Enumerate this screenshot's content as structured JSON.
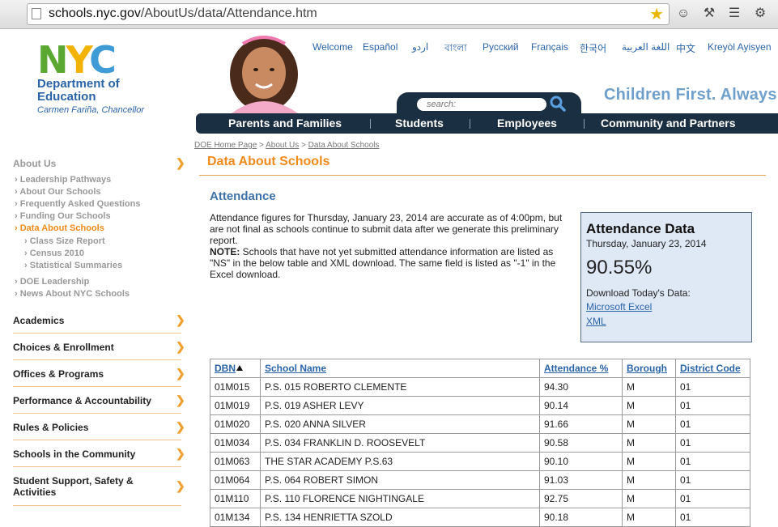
{
  "browser": {
    "url_host": "schools.nyc.gov",
    "url_path": "/AboutUs/data/Attendance.htm"
  },
  "header": {
    "logo_letters": [
      "N",
      "Y",
      "C"
    ],
    "dept_line1": "Department of",
    "dept_line2": "Education",
    "chancellor": "Carmen Fariña, Chancellor",
    "tagline": "Children First.  Always.",
    "search_placeholder": "search:",
    "languages": [
      "Welcome",
      "Español",
      "اردو",
      "বাংলা",
      "Русский",
      "Français",
      "한국어",
      "اللغة العربية",
      "中文",
      "Kreyòl Ayisyen"
    ],
    "nav": [
      "Parents and Families",
      "Students",
      "Employees",
      "Community and Partners"
    ]
  },
  "breadcrumb": [
    "DOE Home Page",
    "About Us",
    "Data About Schools"
  ],
  "page_title": "Data About Schools",
  "sidebar": {
    "section": "About Us",
    "items": [
      {
        "label": "Leadership Pathways",
        "level": 1
      },
      {
        "label": "About Our Schools",
        "level": 1
      },
      {
        "label": "Frequently Asked Questions",
        "level": 1
      },
      {
        "label": "Funding Our Schools",
        "level": 1
      },
      {
        "label": "Data About Schools",
        "level": 1,
        "active": true
      },
      {
        "label": "Class Size Report",
        "level": 2
      },
      {
        "label": "Census 2010",
        "level": 2
      },
      {
        "label": "Statistical Summaries",
        "level": 2
      },
      {
        "label": "DOE Leadership",
        "level": 1
      },
      {
        "label": "News About NYC Schools",
        "level": 1
      }
    ],
    "categories": [
      "Academics",
      "Choices & Enrollment",
      "Offices & Programs",
      "Performance & Accountability",
      "Rules & Policies",
      "Schools in the Community",
      "Student Support, Safety & Activities"
    ]
  },
  "content": {
    "heading": "Attendance",
    "intro": "Attendance figures for Thursday, January 23, 2014 are accurate as of 4:00pm, but are not final as schools continue to submit data after we generate this preliminary report.",
    "note_label": "NOTE:",
    "note": " Schools that have not yet submitted attendance information are listed as \"NS\" in the below table and XML download. The same field is listed as \"-1\" in the Excel download."
  },
  "attendance_box": {
    "title": "Attendance Data",
    "date": "Thursday, January 23, 2014",
    "percent": "90.55%",
    "download_label": "Download Today's Data:",
    "excel": "Microsoft Excel",
    "xml": "XML"
  },
  "table": {
    "columns": [
      "DBN",
      "School Name",
      "Attendance %",
      "Borough",
      "District Code"
    ],
    "rows": [
      [
        "01M015",
        "P.S. 015 ROBERTO CLEMENTE",
        "94.30",
        "M",
        "01"
      ],
      [
        "01M019",
        "P.S. 019 ASHER LEVY",
        "90.14",
        "M",
        "01"
      ],
      [
        "01M020",
        "P.S. 020 ANNA SILVER",
        "91.66",
        "M",
        "01"
      ],
      [
        "01M034",
        "P.S. 034 FRANKLIN D. ROOSEVELT",
        "90.58",
        "M",
        "01"
      ],
      [
        "01M063",
        "THE STAR ACADEMY P.S.63",
        "90.10",
        "M",
        "01"
      ],
      [
        "01M064",
        "P.S. 064 ROBERT SIMON",
        "91.03",
        "M",
        "01"
      ],
      [
        "01M110",
        "P.S. 110 FLORENCE NIGHTINGALE",
        "92.75",
        "M",
        "01"
      ],
      [
        "01M134",
        "P.S. 134 HENRIETTA SZOLD",
        "90.18",
        "M",
        "01"
      ]
    ]
  },
  "colors": {
    "nav_bg": "#1b2f43",
    "accent_orange": "#f08a1a",
    "link_blue": "#2a64a8",
    "box_bg": "#dfe9f6"
  }
}
